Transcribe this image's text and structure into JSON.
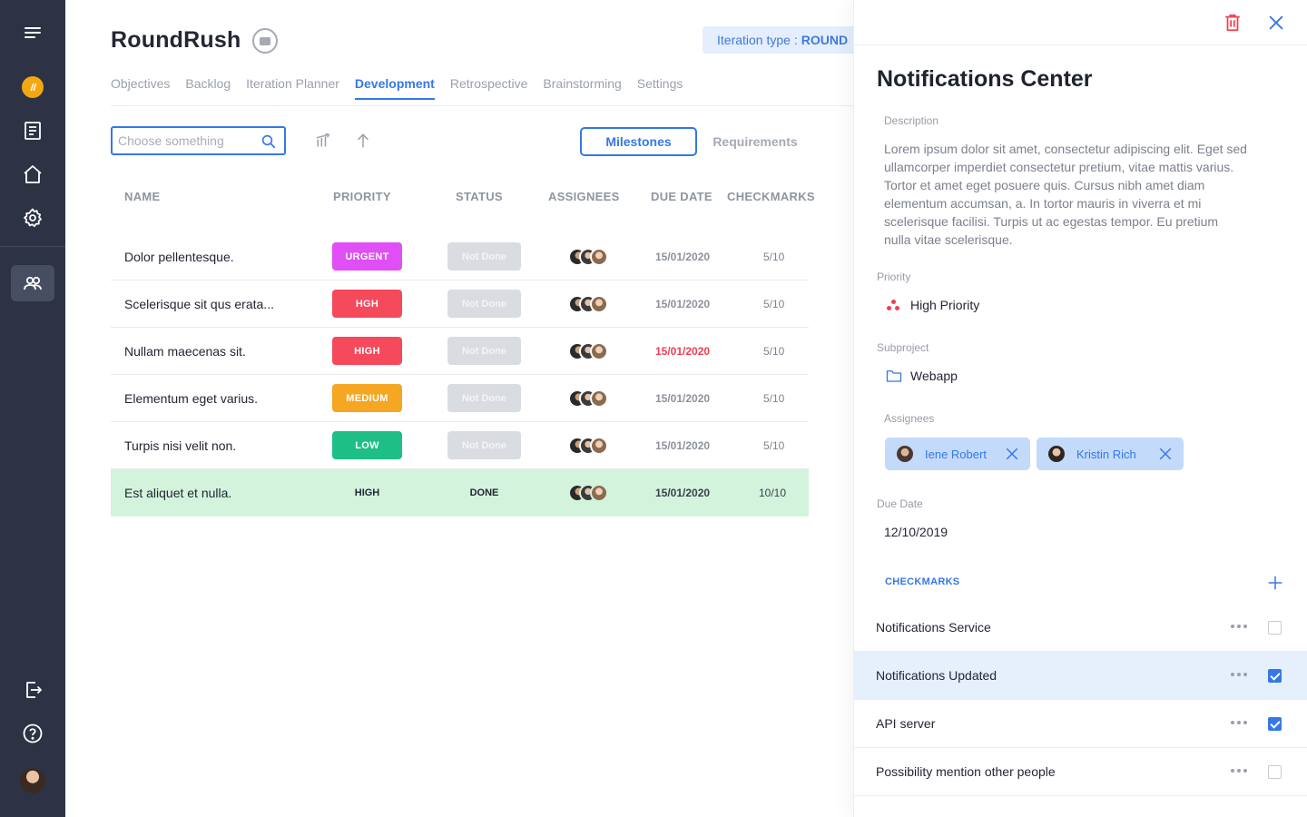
{
  "app": {
    "title": "RoundRush",
    "iteration_label": "Iteration type :",
    "iteration_value": "ROUND"
  },
  "tabs": [
    {
      "label": "Objectives",
      "active": false
    },
    {
      "label": "Backlog",
      "active": false
    },
    {
      "label": "Iteration Planner",
      "active": false
    },
    {
      "label": "Development",
      "active": true
    },
    {
      "label": "Retrospective",
      "active": false
    },
    {
      "label": "Brainstorming",
      "active": false
    },
    {
      "label": "Settings",
      "active": false
    }
  ],
  "toolbar": {
    "search_placeholder": "Choose something",
    "milestones_label": "Milestones",
    "requirements_label": "Requirements"
  },
  "table": {
    "headers": {
      "name": "NAME",
      "priority": "PRIORITY",
      "status": "STATUS",
      "assignees": "ASSIGNEES",
      "due_date": "DUE DATE",
      "checkmarks": "CHECKMARKS"
    },
    "rows": [
      {
        "name": "Dolor pellentesque.",
        "priority": "URGENT",
        "priority_color": "#e04ef5",
        "status": "Not Done",
        "due": "15/01/2020",
        "checkmarks": "5/10"
      },
      {
        "name": "Scelerisque sit qus erata...",
        "priority": "HGH",
        "priority_color": "#f5495c",
        "status": "Not Done",
        "due": "15/01/2020",
        "checkmarks": "5/10"
      },
      {
        "name": "Nullam maecenas sit.",
        "priority": "HIGH",
        "priority_color": "#f5495c",
        "status": "Not Done",
        "due": "15/01/2020",
        "checkmarks": "5/10"
      },
      {
        "name": "Elementum eget varius.",
        "priority": "MEDIUM",
        "priority_color": "#f5a623",
        "status": "Not Done",
        "due": "15/01/2020",
        "checkmarks": "5/10"
      },
      {
        "name": "Turpis nisi velit non.",
        "priority": "LOW",
        "priority_color": "#1dbf86",
        "status": "Not Done",
        "due": "15/01/2020",
        "checkmarks": "5/10"
      },
      {
        "name": "Est aliquet et nulla.",
        "priority": "HIGH",
        "status": "DONE",
        "due": "15/01/2020",
        "checkmarks": "10/10"
      }
    ]
  },
  "panel": {
    "title": "Notifications Center",
    "description_label": "Description",
    "description": "Lorem ipsum dolor sit amet, consectetur adipiscing elit. Eget sed ullamcorper imperdiet consectetur pretium, vitae mattis varius. Tortor et amet eget posuere quis. Cursus nibh amet diam elementum accumsan, a. In tortor mauris in viverra et mi scelerisque facilisi. Turpis ut ac egestas tempor. Eu pretium nulla vitae scelerisque.",
    "priority_label": "Priority",
    "priority_value": "High Priority",
    "subproject_label": "Subproject",
    "subproject_value": "Webapp",
    "assignees_label": "Assignees",
    "assignees": [
      "Iene Robert",
      "Kristin Rich"
    ],
    "due_label": "Due Date",
    "due_value": "12/10/2019",
    "checkmarks_label": "CHECKMARKS",
    "checkmarks": [
      {
        "label": "Notifications Service",
        "checked": false,
        "selected": false
      },
      {
        "label": "Notifications Updated",
        "checked": true,
        "selected": true
      },
      {
        "label": "API server",
        "checked": true,
        "selected": false
      },
      {
        "label": "Possibility mention other people",
        "checked": false,
        "selected": false
      }
    ]
  },
  "colors": {
    "accent": "#3578e5",
    "rail": "#2d3345",
    "done_row": "#d3f3dd",
    "overdue": "#ef3f52"
  }
}
